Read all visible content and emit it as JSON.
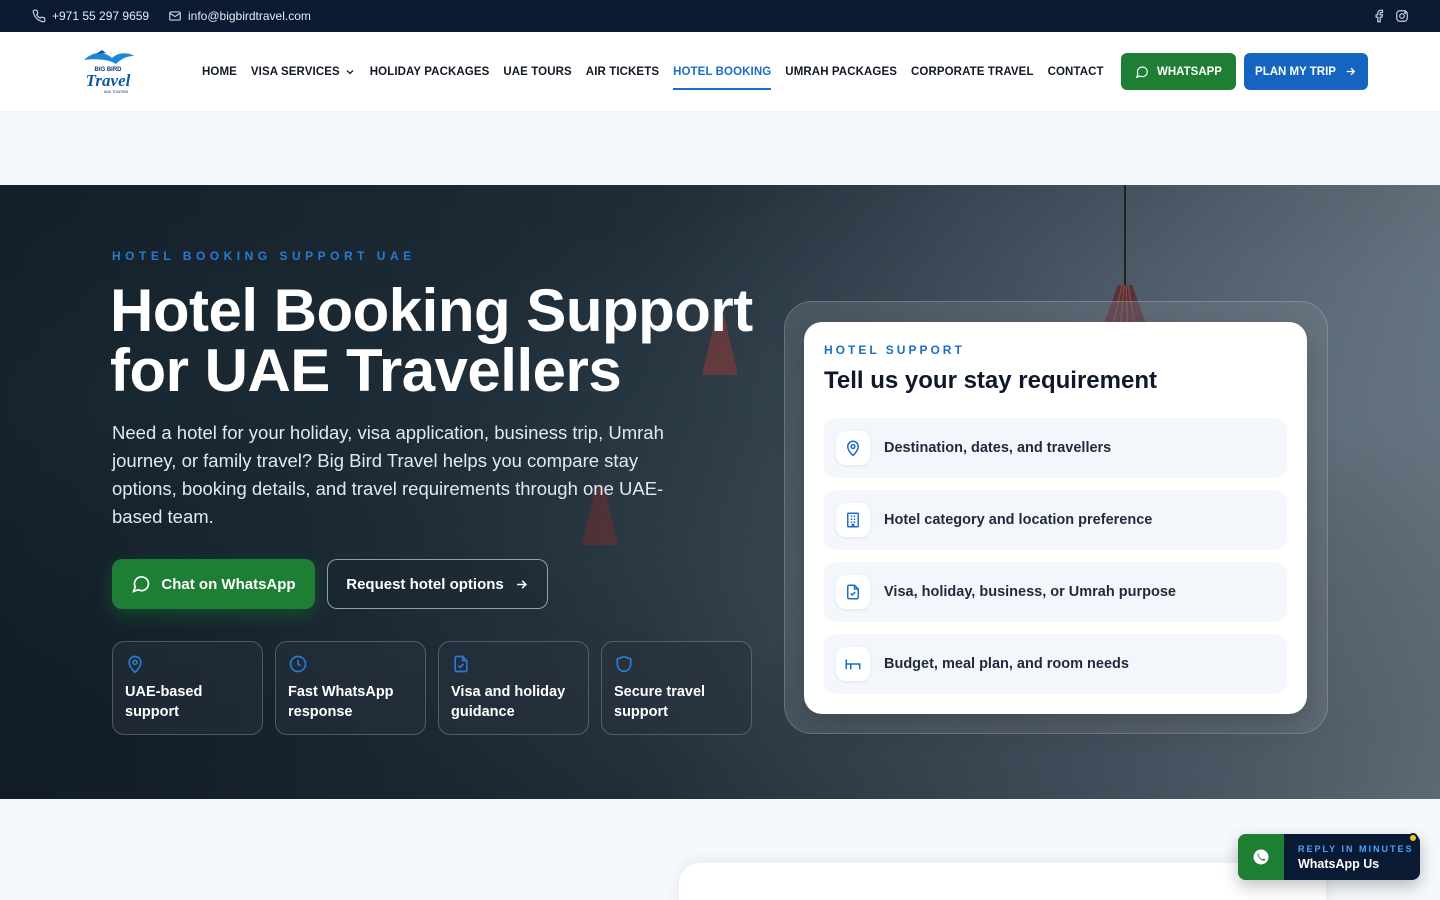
{
  "topbar": {
    "phone": "+971 55 297 9659",
    "email": "info@bigbirdtravel.com",
    "social": [
      "facebook-icon",
      "instagram-icon"
    ]
  },
  "logo": {
    "line1": "BIG BIRD",
    "line2": "Travel",
    "line3": "AND TOURISM"
  },
  "nav": {
    "items": [
      {
        "label": "HOME"
      },
      {
        "label": "VISA SERVICES",
        "has_dropdown": true
      },
      {
        "label": "HOLIDAY PACKAGES"
      },
      {
        "label": "UAE TOURS"
      },
      {
        "label": "AIR TICKETS"
      },
      {
        "label": "HOTEL BOOKING",
        "active": true
      },
      {
        "label": "UMRAH PACKAGES"
      },
      {
        "label": "CORPORATE TRAVEL"
      },
      {
        "label": "CONTACT"
      }
    ],
    "whatsapp_label": "WHATSAPP",
    "plan_label": "PLAN MY TRIP"
  },
  "hero": {
    "eyebrow": "HOTEL BOOKING SUPPORT UAE",
    "title_line1": "Hotel Booking Support",
    "title_line2": "for UAE Travellers",
    "description": "Need a hotel for your holiday, visa application, business trip, Umrah journey, or family travel? Big Bird Travel helps you compare stay options, booking details, and travel requirements through one UAE-based team.",
    "cta_whatsapp": "Chat on WhatsApp",
    "cta_request": "Request hotel options",
    "features": [
      {
        "icon": "location-pin-icon",
        "label": "UAE-based support"
      },
      {
        "icon": "clock-icon",
        "label": "Fast WhatsApp response"
      },
      {
        "icon": "document-icon",
        "label": "Visa and holiday guidance"
      },
      {
        "icon": "shield-icon",
        "label": "Secure travel support"
      }
    ]
  },
  "support_card": {
    "eyebrow": "HOTEL SUPPORT",
    "title": "Tell us your stay requirement",
    "items": [
      {
        "icon": "location-pin-icon",
        "label": "Destination, dates, and travellers"
      },
      {
        "icon": "building-icon",
        "label": "Hotel category and location preference"
      },
      {
        "icon": "document-check-icon",
        "label": "Visa, holiday, business, or Umrah purpose"
      },
      {
        "icon": "bed-icon",
        "label": "Budget, meal plan, and room needs"
      }
    ]
  },
  "whatsapp_float": {
    "small": "REPLY IN MINUTES",
    "big": "WhatsApp Us"
  },
  "colors": {
    "topbar_bg": "#0b1a33",
    "accent_blue": "#1a6fc4",
    "whatsapp_green": "#1e7e34",
    "plan_blue": "#1565c0"
  }
}
